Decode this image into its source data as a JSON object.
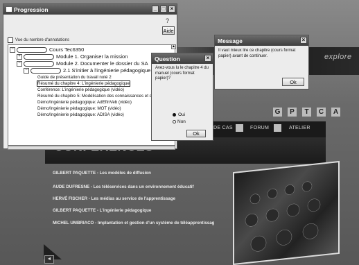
{
  "background": {
    "brand_text": "explore",
    "square_buttons": [
      "G",
      "P",
      "T",
      "C",
      "A"
    ],
    "nav": {
      "item1": "DE CAS",
      "item2": "FORUM",
      "item3": "ATELIER"
    },
    "section_title": "CONFÉRENCES",
    "talks": [
      "GILBERT PAQUETTE - Les modèles de diffusion",
      "AUDE DUFRESNE - Les téléservices dans un environnement éducatif",
      "HERVÉ FISCHER - Les médias au service de l'apprentissage",
      "GILBERT PAQUETTE - L'ingénierie pédagogique",
      "MICHEL UMBRIACO - Implantation et gestion d'un système de téléapprentissag"
    ]
  },
  "progression": {
    "title": "Progression",
    "aide_label": "Aide",
    "checkbox_label": "Vue du nombre d'annotations",
    "tree": {
      "course": "Cours Tec6350",
      "module1": "Module 1. Organiser la mission",
      "module2": "Module 2. Documenter le dossier du SA",
      "section": "2.1 S'initier à l'ingénierie pédagogique",
      "items": [
        "Guide de présentation du travail noté 2",
        "Résumé du chapitre 4: L'ingénierie pédagogique",
        "Conférence: L'ingénierie pédagogique (vidéo)",
        "Résumé du chapitre 5: Modélisation des connaissances et de",
        "Démo/Ingénierie pédagogique: AdEfInVeb (vidéo)",
        "Démo/Ingénierie pédagogique: MOT (vidéo)",
        "Démo/Ingénierie pédagogique: ADISA (vidéo)"
      ]
    }
  },
  "question": {
    "title": "Question",
    "text": "Avez-vous lu le chapitre 4 du manuel (cours format papier)?",
    "option_yes": "Oui",
    "option_no": "Non",
    "ok_label": "Ok"
  },
  "message": {
    "title": "Message",
    "text": "Il vaut mieux lire ce chapitre (cours format papier) avant de continuer.",
    "ok_label": "Ok"
  }
}
